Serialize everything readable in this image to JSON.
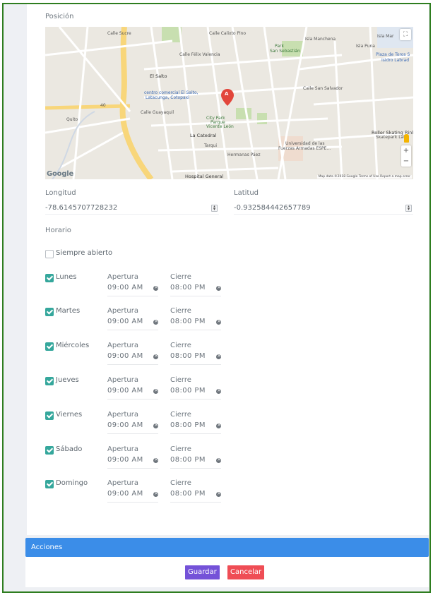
{
  "form": {
    "position_label": "Posición",
    "longitude_label": "Longitud",
    "latitude_label": "Latitud",
    "longitude_value": "-78.6145707728232",
    "latitude_value": "-0.932584442657789",
    "schedule_label": "Horario",
    "always_open_label": "Siempre abierto",
    "always_open_checked": false
  },
  "map": {
    "labels": [
      "Calle Sucre",
      "Calle Calixto Pino",
      "Isla Manchena",
      "Isla Mar",
      "Isla Puna",
      "Calle Félix Valencia",
      "Park",
      "San Sebastián",
      "Plaza de Toros S",
      "Isidro Labrad",
      "El Salto",
      "centro comercial El Salto,",
      "Latacunga, Cotopaxi",
      "City Park",
      "Parque",
      "Vicente León",
      "La Catedral",
      "Roller Skating Rink",
      "Skatepark Lat",
      "Universidad de las",
      "Fuerzas Armadas ESPE...",
      "Hermanas Páez",
      "Hospital General",
      "Calle Guayaquil",
      "Tarqui",
      "Calle San Salvador",
      "Quito",
      "40"
    ],
    "google": "Google",
    "attribution": "Map data ©2018 Google   Terms of Use   Report a map error",
    "marker": "A",
    "fullscreen_icon": "fullscreen-icon",
    "zoom_in": "+",
    "zoom_out": "−"
  },
  "schedule": {
    "open_label": "Apertura",
    "close_label": "Cierre",
    "days": [
      {
        "name": "Lunes",
        "checked": true,
        "open": "09:00 AM",
        "close": "08:00 PM"
      },
      {
        "name": "Martes",
        "checked": true,
        "open": "09:00 AM",
        "close": "08:00 PM"
      },
      {
        "name": "Miércoles",
        "checked": true,
        "open": "09:00 AM",
        "close": "08:00 PM"
      },
      {
        "name": "Jueves",
        "checked": true,
        "open": "09:00 AM",
        "close": "08:00 PM"
      },
      {
        "name": "Viernes",
        "checked": true,
        "open": "09:00 AM",
        "close": "08:00 PM"
      },
      {
        "name": "Sábado",
        "checked": true,
        "open": "09:00 AM",
        "close": "08:00 PM"
      },
      {
        "name": "Domingo",
        "checked": true,
        "open": "09:00 AM",
        "close": "08:00 PM"
      }
    ]
  },
  "actions": {
    "header": "Acciones",
    "save_label": "Guardar",
    "cancel_label": "Cancelar"
  },
  "colors": {
    "accent_blue": "#3b8de8",
    "save": "#7452d8",
    "cancel": "#ef4d55",
    "check": "#35a79c",
    "frame_border": "#2e7d1f"
  }
}
